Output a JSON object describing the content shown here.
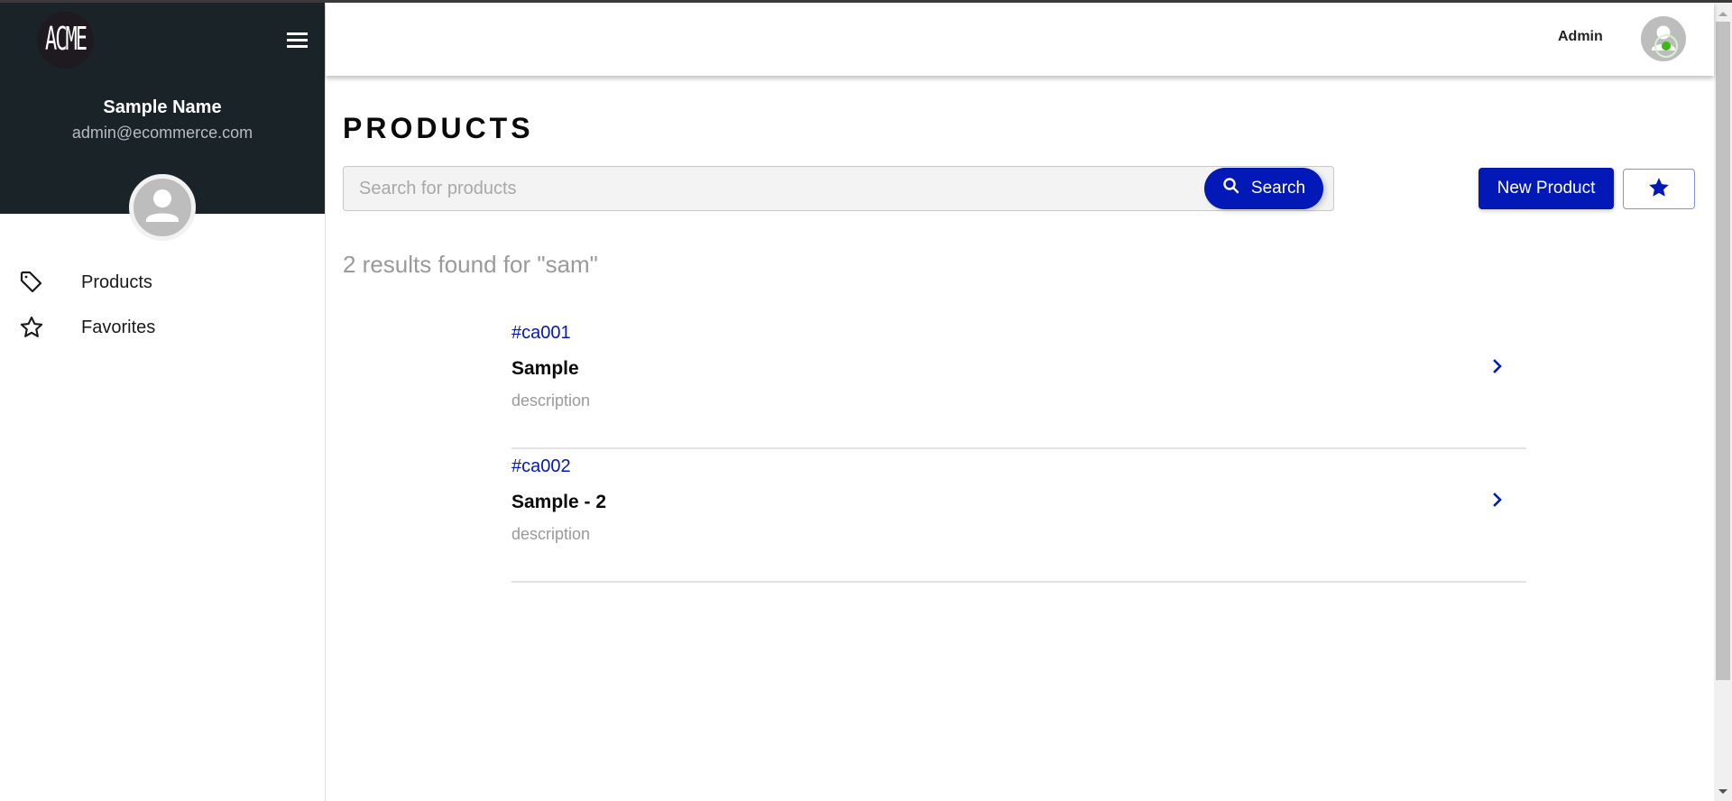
{
  "sidebar": {
    "logo_text": "ACME",
    "menu_icon": "hamburger-menu-icon",
    "user": {
      "name": "Sample Name",
      "email": "admin@ecommerce.com",
      "avatar_icon": "user-avatar-icon"
    },
    "nav": [
      {
        "label": "Products",
        "icon": "tag-icon"
      },
      {
        "label": "Favorites",
        "icon": "star-outline-icon"
      }
    ]
  },
  "header": {
    "user_label": "Admin",
    "avatar_icon": "user-avatar-icon",
    "status": "online",
    "status_color": "#3cb914"
  },
  "main": {
    "title": "PRODUCTS",
    "search": {
      "placeholder": "Search for products",
      "value": "",
      "button_label": "Search",
      "button_icon": "search-icon"
    },
    "new_product_label": "New Product",
    "favorites_button_icon": "star-filled-icon",
    "results_summary": "2 results found for \"sam\"",
    "results": [
      {
        "code": "#ca001",
        "name": "Sample",
        "description": "description"
      },
      {
        "code": "#ca002",
        "name": "Sample - 2",
        "description": "description"
      }
    ]
  },
  "colors": {
    "primary": "#0219b8",
    "sidebar_bg": "#1a2428",
    "muted_text": "#9a9a9a"
  }
}
